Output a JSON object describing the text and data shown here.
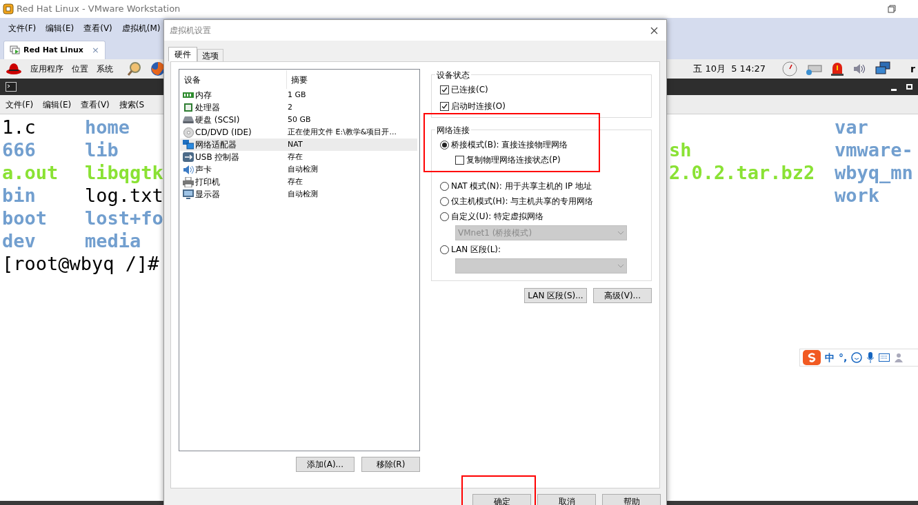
{
  "window": {
    "title": "Red Hat Linux - VMware Workstation"
  },
  "menu": [
    "文件(F)",
    "编辑(E)",
    "查看(V)",
    "虚拟机(M)"
  ],
  "vm_tab": {
    "label": "Red Hat Linux",
    "close": "×"
  },
  "gnome_panel": {
    "menus": [
      "应用程序",
      "位置",
      "系统"
    ],
    "clock": "五 10月  5 14:27",
    "user": "r"
  },
  "terminal": {
    "menu": [
      "文件(F)",
      "编辑(E)",
      "查看(V)",
      "搜索(S"
    ],
    "left_rows": [
      [
        {
          "text": "1.c",
          "kind": "file"
        },
        {
          "text": "home",
          "kind": "dir"
        }
      ],
      [
        {
          "text": "666",
          "kind": "dir"
        },
        {
          "text": "lib",
          "kind": "dir"
        }
      ],
      [
        {
          "text": "a.out",
          "kind": "exec"
        },
        {
          "text": "libqgtk",
          "kind": "exec"
        }
      ],
      [
        {
          "text": "bin",
          "kind": "dir"
        },
        {
          "text": "log.txt",
          "kind": "file"
        }
      ],
      [
        {
          "text": "boot",
          "kind": "dir"
        },
        {
          "text": "lost+fo",
          "kind": "dir"
        }
      ],
      [
        {
          "text": "dev",
          "kind": "dir"
        },
        {
          "text": "media",
          "kind": "dir"
        }
      ]
    ],
    "prompt": "[root@wbyq /]#",
    "right_column_1": [
      {
        "text": "sh",
        "kind": "exec"
      },
      {
        "text": "2.0.2.tar.bz2",
        "kind": "exec"
      }
    ],
    "right_column_2": [
      {
        "text": "var",
        "kind": "dir"
      },
      {
        "text": "vmware-",
        "kind": "dir"
      },
      {
        "text": "wbyq_mn",
        "kind": "dir"
      },
      {
        "text": "work",
        "kind": "dir"
      }
    ]
  },
  "ime_toolbar": {
    "texts": [
      "中",
      "°,"
    ]
  },
  "dialog": {
    "title": "虚拟机设置",
    "tabs": [
      {
        "label": "硬件",
        "selected": true
      },
      {
        "label": "选项",
        "selected": false
      }
    ],
    "device_list": {
      "columns": [
        "设备",
        "摘要"
      ],
      "rows": [
        {
          "device": "内存",
          "summary": "1 GB",
          "kind": "memory",
          "selected": false
        },
        {
          "device": "处理器",
          "summary": "2",
          "kind": "cpu",
          "selected": false
        },
        {
          "device": "硬盘 (SCSI)",
          "summary": "50 GB",
          "kind": "disk",
          "selected": false
        },
        {
          "device": "CD/DVD (IDE)",
          "summary": "正在使用文件 E:\\教学&项目开...",
          "kind": "cd",
          "selected": false
        },
        {
          "device": "网络适配器",
          "summary": "NAT",
          "kind": "network",
          "selected": true
        },
        {
          "device": "USB 控制器",
          "summary": "存在",
          "kind": "usb",
          "selected": false
        },
        {
          "device": "声卡",
          "summary": "自动检测",
          "kind": "sound",
          "selected": false
        },
        {
          "device": "打印机",
          "summary": "存在",
          "kind": "printer",
          "selected": false
        },
        {
          "device": "显示器",
          "summary": "自动检测",
          "kind": "display",
          "selected": false
        }
      ]
    },
    "list_buttons": [
      "添加(A)...",
      "移除(R)"
    ],
    "device_status": {
      "title": "设备状态",
      "options": [
        {
          "label": "已连接(C)",
          "checked": true
        },
        {
          "label": "启动时连接(O)",
          "checked": true
        }
      ]
    },
    "network": {
      "title": "网络连接",
      "options": [
        {
          "label": "桥接模式(B): 直接连接物理网络",
          "selected": true,
          "sub_option": {
            "label": "复制物理网络连接状态(P)",
            "checked": false
          }
        },
        {
          "label": "NAT 模式(N): 用于共享主机的 IP 地址",
          "selected": false
        },
        {
          "label": "仅主机模式(H): 与主机共享的专用网络",
          "selected": false
        },
        {
          "label": "自定义(U): 特定虚拟网络",
          "selected": false,
          "select": {
            "value": "VMnet1 (桥接模式)",
            "disabled": true
          }
        },
        {
          "label": "LAN 区段(L):",
          "selected": false,
          "select": {
            "disabled": true
          }
        }
      ]
    },
    "network_buttons": [
      "LAN 区段(S)...",
      "高级(V)..."
    ],
    "footer_buttons": [
      "确定",
      "取消",
      "帮助"
    ]
  }
}
